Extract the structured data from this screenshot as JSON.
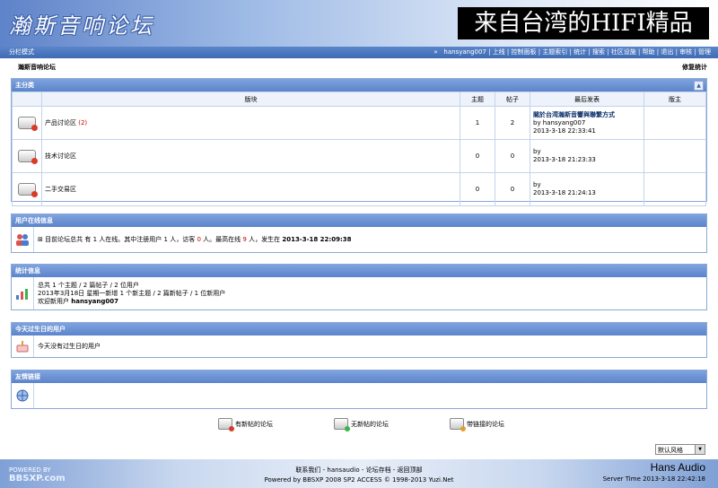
{
  "header": {
    "logo": "瀚斯音响论坛",
    "banner": "来自台湾的HIFI精品"
  },
  "topbar": {
    "mode": "分栏模式",
    "nav_prefix": "»",
    "user": "hansyang007",
    "links": [
      "上线",
      "控制面板",
      "主题索引",
      "统计",
      "搜索",
      "社区设施",
      "帮助",
      "退出",
      "审核",
      "管理"
    ]
  },
  "breadcrumb": "瀚斯音响论坛",
  "repair_stats": "修复统计",
  "main_category": {
    "title": "主分类",
    "collapse": "▲",
    "columns": [
      "版块",
      "主题",
      "帖子",
      "最后发表",
      "版主"
    ],
    "forums": [
      {
        "name": "产品讨论区",
        "badge": "(2)",
        "topics": "1",
        "posts": "2",
        "last_title": "關於台湾瀚斯音響與聯繫方式",
        "last_by": "by hansyang007",
        "last_time": "2013-3-18 22:33:41"
      },
      {
        "name": "技术讨论区",
        "badge": "",
        "topics": "0",
        "posts": "0",
        "last_title": "",
        "last_by": "by",
        "last_time": "2013-3-18 21:23:33"
      },
      {
        "name": "二手交易区",
        "badge": "",
        "topics": "0",
        "posts": "0",
        "last_title": "",
        "last_by": "by",
        "last_time": "2013-3-18 21:24:13"
      }
    ]
  },
  "online": {
    "title": "用户在线信息",
    "toggle": "⊞",
    "text_1": "目前论坛总共 有",
    "total": "1",
    "text_2": "人在线。其中注册用户",
    "registered": "1",
    "text_3": "人，访客",
    "guests": "0",
    "text_4": "人。最高在线",
    "peak": "9",
    "text_5": "人，发生在",
    "peak_time": "2013-3-18 22:09:38"
  },
  "stats": {
    "title": "统计信息",
    "line1": "总共 1 个主题 / 2 篇帖子 / 2 位用户",
    "line2": "2013年3月18日 星期一新增 1 个新主题 / 2 篇新帖子 / 1 位新用户",
    "line3_prefix": "欢迎新用户",
    "line3_user": "hansyang007"
  },
  "birthday": {
    "title": "今天过生日的用户",
    "text": "今天没有过生日的用户"
  },
  "links": {
    "title": "友情链接"
  },
  "legend": {
    "new": "有新帖的论坛",
    "none": "无新帖的论坛",
    "link": "带链接的论坛"
  },
  "style_select": "默认风格",
  "footer": {
    "line1": "联系我们 - hansaudio - 论坛存档 - 返回顶部",
    "line2": "Powered by BBSXP 2008 SP2 ACCESS © 1998-2013 Yuzi.Net",
    "brand": "Hans Audio",
    "server_time": "Server Time 2013-3-18 22:42:18",
    "powered_small": "POWERED BY",
    "powered_big": "BBSXP.com"
  },
  "colors": {
    "accent": "#3f6bb5",
    "panel_head": "#5b84cb",
    "highlight": "#cc0000"
  }
}
